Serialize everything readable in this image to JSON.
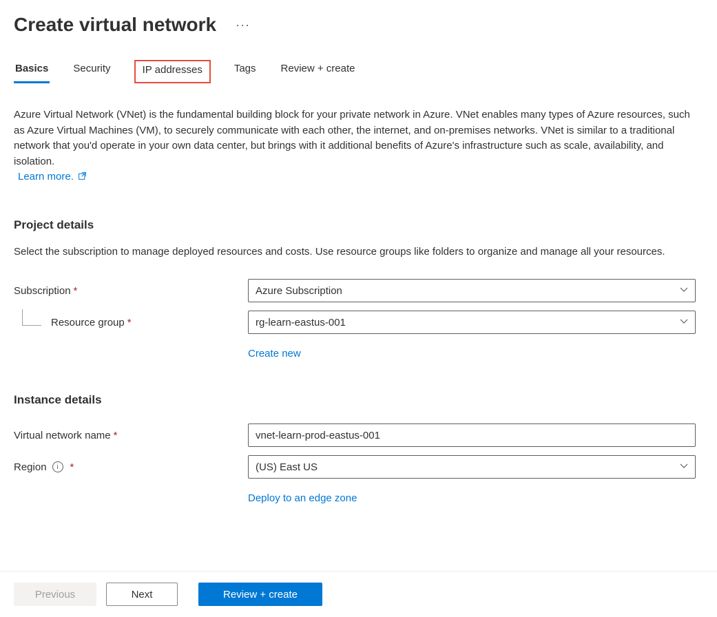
{
  "page": {
    "title": "Create virtual network",
    "more": "···"
  },
  "tabs": {
    "basics": "Basics",
    "security": "Security",
    "ip_addresses": "IP addresses",
    "tags": "Tags",
    "review_create": "Review + create"
  },
  "description": "Azure Virtual Network (VNet) is the fundamental building block for your private network in Azure. VNet enables many types of Azure resources, such as Azure Virtual Machines (VM), to securely communicate with each other, the internet, and on-premises networks. VNet is similar to a traditional network that you'd operate in your own data center, but brings with it additional benefits of Azure's infrastructure such as scale, availability, and isolation.",
  "learn_more": "Learn more.",
  "project_details": {
    "title": "Project details",
    "description": "Select the subscription to manage deployed resources and costs. Use resource groups like folders to organize and manage all your resources.",
    "subscription_label": "Subscription",
    "subscription_value": "Azure Subscription",
    "resource_group_label": "Resource group",
    "resource_group_value": "rg-learn-eastus-001",
    "create_new": "Create new"
  },
  "instance_details": {
    "title": "Instance details",
    "vnet_name_label": "Virtual network name",
    "vnet_name_value": "vnet-learn-prod-eastus-001",
    "region_label": "Region",
    "region_value": "(US) East US",
    "deploy_edge": "Deploy to an edge zone"
  },
  "footer": {
    "previous": "Previous",
    "next": "Next",
    "review_create": "Review + create"
  }
}
